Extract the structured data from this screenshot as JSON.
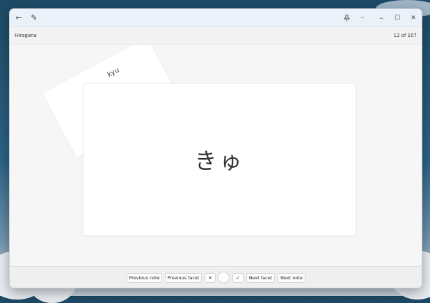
{
  "desktop": {},
  "window": {
    "titlebar": {
      "back_glyph": "←",
      "edit_glyph": "✎",
      "pin_glyph": "📌",
      "more_glyph": "···",
      "minimize_glyph": "–",
      "maximize_glyph": "☐",
      "close_glyph": "✕"
    },
    "subbar": {
      "deck": "Hiragana",
      "counter": "12 of 107"
    },
    "card": {
      "back_text": "kyu",
      "front_text": "きゅ"
    },
    "controls": {
      "previous_note": "Previous note",
      "previous_facet": "Previous facet",
      "wrong": "✕",
      "correct": "✓",
      "next_facet": "Next facet",
      "next_note": "Next note"
    }
  }
}
